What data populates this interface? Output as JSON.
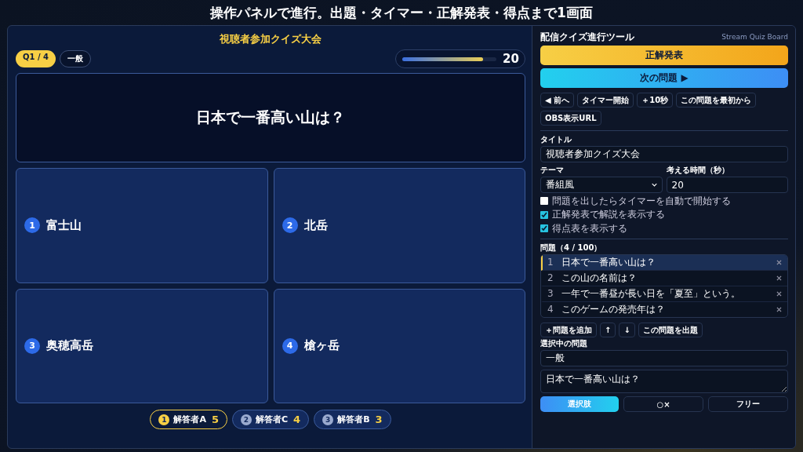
{
  "headline": "操作パネルで進行。出題・タイマー・正解発表・得点まで1画面",
  "stage": {
    "title": "視聴者参加クイズ大会",
    "counter": "Q1 / 4",
    "category": "一般",
    "timer": {
      "level": 0.86,
      "reading": "20"
    },
    "question": "日本で一番高い山は？",
    "answers": [
      {
        "number": "1",
        "text": "富士山"
      },
      {
        "number": "2",
        "text": "北岳"
      },
      {
        "number": "3",
        "text": "奥穂高岳"
      },
      {
        "number": "4",
        "text": "槍ヶ岳"
      }
    ],
    "scores": [
      {
        "rank": "1",
        "name": "解答者A",
        "score": "5",
        "leader": true
      },
      {
        "rank": "2",
        "name": "解答者C",
        "score": "4",
        "leader": false
      },
      {
        "rank": "3",
        "name": "解答者B",
        "score": "3",
        "leader": false
      }
    ]
  },
  "panel": {
    "title": "配信クイズ進行ツール",
    "subtitle": "Stream Quiz Board",
    "reveal_button": "正解発表",
    "next_button": "次の問題 ▶",
    "small_buttons": [
      "◀ 前へ",
      "タイマー開始",
      "＋10秒",
      "この問題を最初から",
      "OBS表示URL"
    ],
    "title_label": "タイトル",
    "title_value": "視聴者参加クイズ大会",
    "theme_label": "テーマ",
    "theme_value": "番組風",
    "time_label": "考える時間（秒）",
    "time_value": "20",
    "options": [
      {
        "label": "問題を出したらタイマーを自動で開始する",
        "checked": false
      },
      {
        "label": "正解発表で解説を表示する",
        "checked": true
      },
      {
        "label": "得点表を表示する",
        "checked": true
      }
    ],
    "list_label": "問題（4 / 100）",
    "questions": [
      {
        "number": "1",
        "text": "日本で一番高い山は？",
        "selected": true
      },
      {
        "number": "2",
        "text": "この山の名前は？",
        "selected": false
      },
      {
        "number": "3",
        "text": "一年で一番昼が長い日を「夏至」という。",
        "selected": false
      },
      {
        "number": "4",
        "text": "このゲームの発売年は？",
        "selected": false
      }
    ],
    "list_buttons": [
      "＋問題を追加",
      "↑",
      "↓",
      "この問題を出題"
    ],
    "selected_label": "選択中の問題",
    "selected_category": "一般",
    "selected_text": "日本で一番高い山は？",
    "modes": [
      {
        "label": "選択肢",
        "selected": true
      },
      {
        "label": "○×",
        "selected": false
      },
      {
        "label": "フリー",
        "selected": false
      }
    ]
  }
}
